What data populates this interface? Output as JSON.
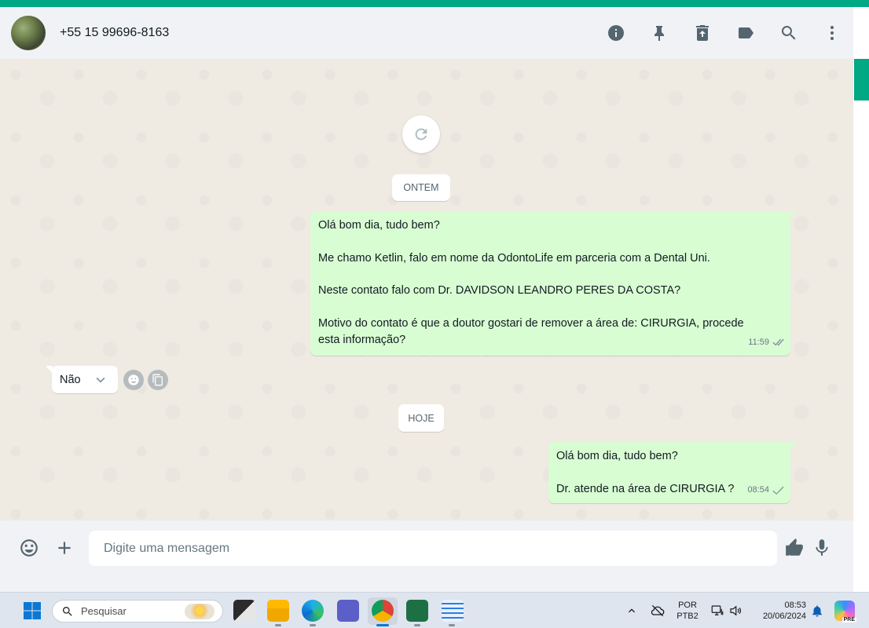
{
  "header": {
    "contact_name": "+55 15 99696-8163",
    "icons": [
      "info-icon",
      "pin-icon",
      "archive-icon",
      "label-icon",
      "search-icon",
      "more-vertical-icon"
    ]
  },
  "chat": {
    "date_chips": {
      "yesterday": "ONTEM",
      "today": "HOJE"
    },
    "messages": {
      "out1": {
        "lines": [
          "Olá bom dia, tudo bem?",
          "",
          "Me chamo Ketlin, falo em nome da OdontoLife em parceria com a Dental Uni.",
          "",
          "Neste contato falo com Dr. DAVIDSON LEANDRO PERES DA COSTA?",
          "",
          "Motivo do contato é que a doutor gostari de remover a área de: CIRURGIA, procede",
          "esta informação?"
        ],
        "time": "11:59",
        "status": "read"
      },
      "in1": {
        "text": "Não",
        "icon": "chevron-down-icon"
      },
      "out2": {
        "lines": [
          "Olá bom dia, tudo bem?",
          "",
          "Dr. atende na área de CIRURGIA ?"
        ],
        "time": "08:54",
        "status": "delivered"
      }
    }
  },
  "footer": {
    "placeholder": "Digite uma mensagem"
  },
  "taskbar": {
    "search_label": "Pesquisar",
    "lang_top": "POR",
    "lang_bottom": "PTB2",
    "time": "08:53",
    "date": "20/06/2024",
    "copilot_badge": "PRE"
  },
  "colors": {
    "accent": "#00a884",
    "outgoing_bubble": "#d9fdd3",
    "chat_background": "#efeae2",
    "header_background": "#f0f2f5"
  }
}
